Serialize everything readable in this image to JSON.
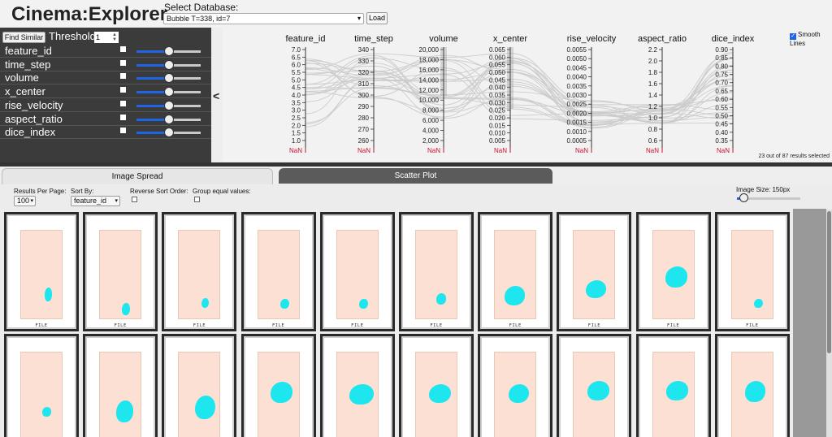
{
  "header": {
    "title": "Cinema:Explorer",
    "db_label": "Select Database:",
    "db_selected": "Bubble T=338, id=7",
    "load_label": "Load"
  },
  "controls": {
    "find_similar_label": "Find Similar",
    "threshold_label": "Threshold:",
    "threshold_value": "1",
    "dimensions": [
      {
        "label": "feature_id",
        "slider": 0.5
      },
      {
        "label": "time_step",
        "slider": 0.5
      },
      {
        "label": "volume",
        "slider": 0.5
      },
      {
        "label": "x_center",
        "slider": 0.5
      },
      {
        "label": "rise_velocity",
        "slider": 0.5
      },
      {
        "label": "aspect_ratio",
        "slider": 0.5
      },
      {
        "label": "dice_index",
        "slider": 0.5
      }
    ]
  },
  "collapse_glyph": "<",
  "pcp": {
    "smooth_label": "Smooth Lines",
    "selected_count_text": "23 out of 87 results selected",
    "nan_label": "NaN",
    "line_color": "#cccccc",
    "nan_color": "#c8102e",
    "axes": [
      {
        "name": "feature_id",
        "ticks": [
          "7.0",
          "6.5",
          "6.0",
          "5.5",
          "5.0",
          "4.5",
          "4.0",
          "3.5",
          "3.0",
          "2.5",
          "2.0",
          "1.5",
          "1.0"
        ]
      },
      {
        "name": "time_step",
        "ticks": [
          "340",
          "330",
          "320",
          "310",
          "300",
          "290",
          "280",
          "270",
          "260"
        ]
      },
      {
        "name": "volume",
        "ticks": [
          "20,000",
          "18,000",
          "16,000",
          "14,000",
          "12,000",
          "10,000",
          "8,000",
          "6,000",
          "4,000",
          "2,000"
        ]
      },
      {
        "name": "x_center",
        "ticks": [
          "0.065",
          "0.060",
          "0.055",
          "0.050",
          "0.045",
          "0.040",
          "0.035",
          "0.030",
          "0.025",
          "0.020",
          "0.015",
          "0.010",
          "0.005"
        ]
      },
      {
        "name": "rise_velocity",
        "ticks": [
          "0.0055",
          "0.0050",
          "0.0045",
          "0.0040",
          "0.0035",
          "0.0030",
          "0.0025",
          "0.0020",
          "0.0015",
          "0.0010",
          "0.0005"
        ]
      },
      {
        "name": "aspect_ratio",
        "ticks": [
          "2.2",
          "2.0",
          "1.8",
          "1.6",
          "1.4",
          "1.2",
          "1.0",
          "0.8",
          "0.6"
        ]
      },
      {
        "name": "dice_index",
        "ticks": [
          "0.90",
          "0.85",
          "0.80",
          "0.75",
          "0.70",
          "0.65",
          "0.60",
          "0.55",
          "0.50",
          "0.45",
          "0.40",
          "0.35"
        ]
      }
    ]
  },
  "tabs": [
    {
      "label": "Image Spread",
      "active": true
    },
    {
      "label": "Scatter Plot",
      "active": false
    }
  ],
  "options": {
    "results_per_page_label": "Results Per Page:",
    "results_per_page_value": "100",
    "sort_by_label": "Sort By:",
    "sort_by_value": "feature_id",
    "reverse_label": "Reverse Sort Order:",
    "group_label": "Group equal values:",
    "image_size_label": "Image Size: 150px",
    "image_size_value": 0.12
  },
  "grid": {
    "file_label": "FILE",
    "columns": 10,
    "rows": 2,
    "blob_color": "#1ee6ef",
    "background_color": "#fde0d4"
  }
}
